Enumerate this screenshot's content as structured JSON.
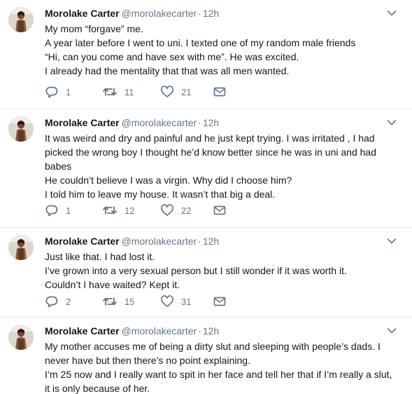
{
  "colors": {
    "icon": "#657786",
    "text": "#14171a",
    "secondary": "#657786",
    "divider": "#e6ecf0"
  },
  "tweets": [
    {
      "name": "Morolake Carter",
      "handle": "@morolakecarter",
      "dot": "·",
      "time": "12h",
      "lines": [
        "My mom “forgave” me.",
        "A year later before I went to uni. I texted one of my random male friends",
        "“Hi, can you come and have sex with me”. He was excited.",
        "I already had the mentality that that was all men wanted."
      ],
      "replies": "1",
      "retweets": "11",
      "likes": "21"
    },
    {
      "name": "Morolake Carter",
      "handle": "@morolakecarter",
      "dot": "·",
      "time": "12h",
      "lines": [
        "It was weird and dry and painful and he just kept trying. I was irritated , I had",
        "picked the wrong boy I thought he’d know better since he was in uni and had",
        "babes",
        "He couldn’t believe I was a virgin. Why did I choose him?",
        "I told him to leave my house.  It wasn’t that big a deal."
      ],
      "replies": "1",
      "retweets": "12",
      "likes": "22"
    },
    {
      "name": "Morolake Carter",
      "handle": "@morolakecarter",
      "dot": "·",
      "time": "12h",
      "lines": [
        "Just like that. I had lost it.",
        "I’ve grown into a very sexual person but I still wonder if it was worth it.",
        "Couldn’t I have waited? Kept it."
      ],
      "replies": "2",
      "retweets": "15",
      "likes": "31"
    },
    {
      "name": "Morolake Carter",
      "handle": "@morolakecarter",
      "dot": "·",
      "time": "12h",
      "lines": [
        "My mother accuses me of being a dirty slut and sleeping with people’s dads. I",
        "never have but then there’s no point explaining.",
        "I’m 25 now and I really want to spit in her face and tell her that if I’m really a slut,",
        "it is only because of her."
      ]
    }
  ]
}
